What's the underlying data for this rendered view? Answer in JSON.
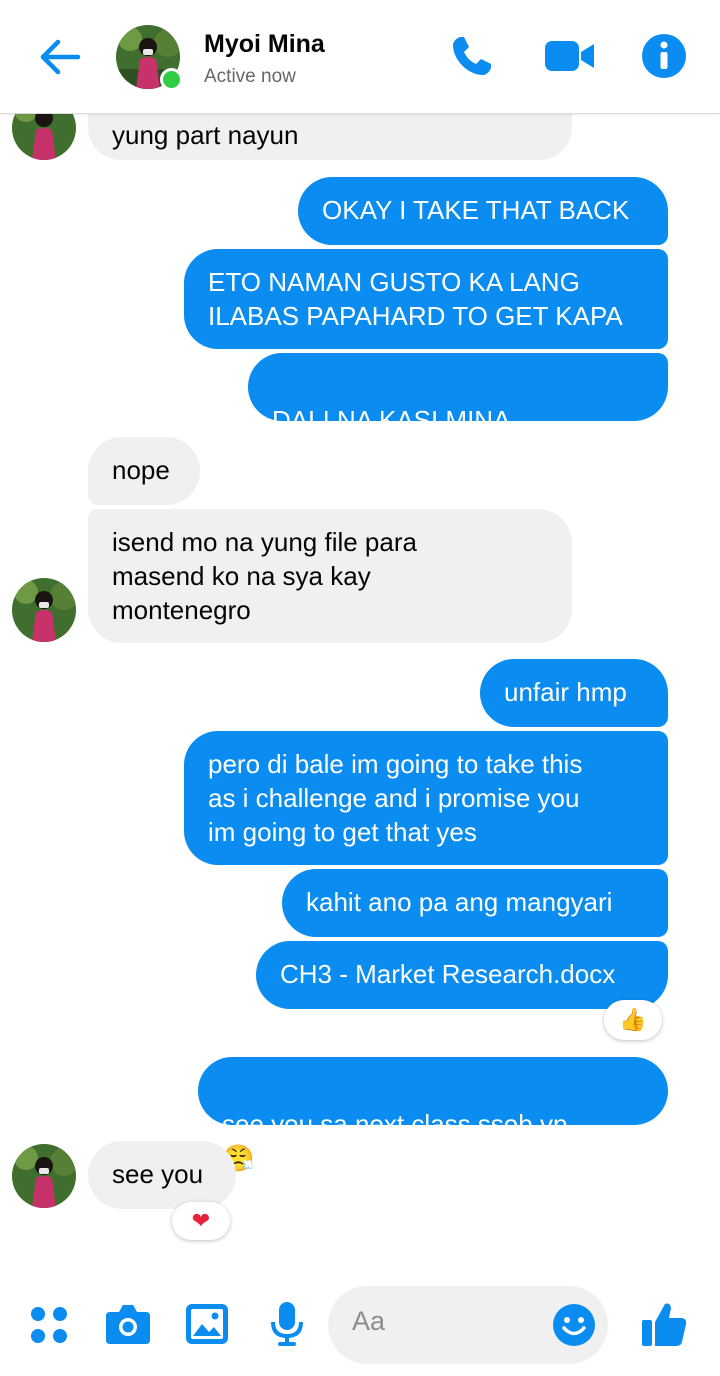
{
  "header": {
    "contact_name": "Myoi Mina",
    "status": "Active now",
    "icons": [
      "back-arrow-icon",
      "phone-icon",
      "video-camera-icon",
      "info-icon"
    ],
    "accent_color": "#0a8cf0"
  },
  "messages": [
    {
      "side": "in",
      "text": "yung part nayun"
    },
    {
      "side": "out",
      "text": "OKAY I TAKE THAT BACK"
    },
    {
      "side": "out",
      "text": "ETO NAMAN GUSTO KA LANG\nILABAS PAPAHARD TO GET KAPA"
    },
    {
      "side": "out",
      "text": "DALI NA KASI MINA",
      "emoji": "😭😭😭"
    },
    {
      "side": "in",
      "text": "nope"
    },
    {
      "side": "in",
      "text": "isend mo na yung file para\nmasend ko na sya kay\nmontenegro"
    },
    {
      "side": "out",
      "text": "unfair hmp"
    },
    {
      "side": "out",
      "text": "pero di bale im going to take this\nas i challenge and i promise you\nim going to get that yes"
    },
    {
      "side": "out",
      "text": "kahit ano pa ang mangyari"
    },
    {
      "side": "out",
      "text": "CH3 - Market Research.docx",
      "reaction": "👍"
    },
    {
      "side": "out",
      "text": "see you sa next class ssob vp",
      "emoji": "😤"
    },
    {
      "side": "in",
      "text": "see you",
      "reaction": "❤"
    }
  ],
  "composer": {
    "placeholder": "Aa",
    "icons": [
      "apps-grid-icon",
      "camera-icon",
      "gallery-icon",
      "microphone-icon",
      "emoji-icon",
      "thumbs-up-icon"
    ]
  }
}
